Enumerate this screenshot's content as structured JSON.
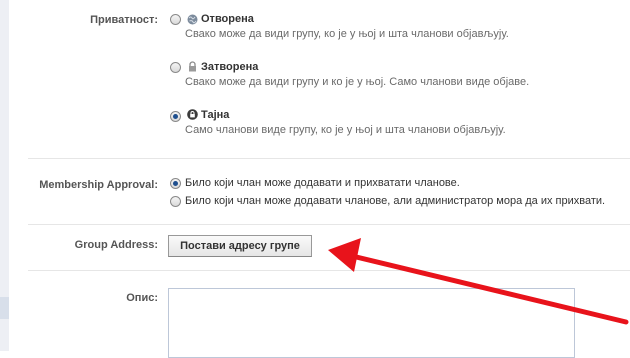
{
  "privacy": {
    "label": "Приватност:",
    "options": [
      {
        "title": "Отворена",
        "desc": "Свако може да види групу, ко је у њој и шта чланови објављују.",
        "icon": "globe-icon",
        "checked": false
      },
      {
        "title": "Затворена",
        "desc": "Свако може да види групу и ко је у њој. Само чланови виде објаве.",
        "icon": "lock-icon",
        "checked": false
      },
      {
        "title": "Тајна",
        "desc": "Само чланови виде групу, ко је у њој и шта чланови објављују.",
        "icon": "secret-lock-icon",
        "checked": true
      }
    ]
  },
  "membership": {
    "label": "Membership Approval:",
    "options": [
      {
        "text": "Било који члан може додавати и прихватати чланове.",
        "checked": true
      },
      {
        "text": "Било који члан може додавати чланове, али администратор мора да их прихвати.",
        "checked": false
      }
    ]
  },
  "address": {
    "label": "Group Address:",
    "button": "Постави адресу групе"
  },
  "description": {
    "label": "Опис:"
  },
  "colors": {
    "annotation_arrow": "#e8131b"
  }
}
